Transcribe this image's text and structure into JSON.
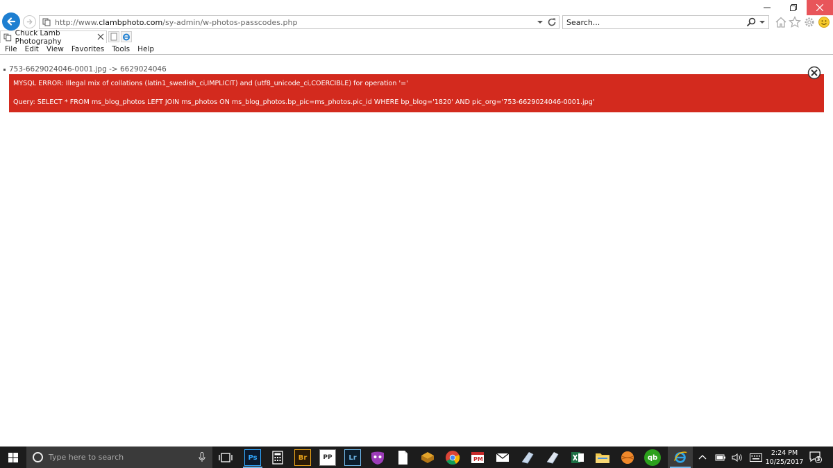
{
  "browser": {
    "url_prefix": "http://www.",
    "url_domain": "clambphoto.com",
    "url_path": "/sy-admin/w-photos-passcodes.php",
    "search_placeholder": "Search...",
    "tab_title": "Chuck Lamb Photography"
  },
  "menu": [
    "File",
    "Edit",
    "View",
    "Favorites",
    "Tools",
    "Help"
  ],
  "page": {
    "file_line": "753-6629024046-0001.jpg -> 6629024046",
    "error_line": "MYSQL ERROR: Illegal mix of collations (latin1_swedish_ci,IMPLICIT) and (utf8_unicode_ci,COERCIBLE) for operation '='",
    "query_line": "Query: SELECT * FROM ms_blog_photos LEFT JOIN ms_photos ON ms_blog_photos.bp_pic=ms_photos.pic_id WHERE bp_blog='1820' AND pic_org='753-6629024046-0001.jpg'"
  },
  "taskbar": {
    "search_placeholder": "Type here to search",
    "time": "2:24 PM",
    "date": "10/25/2017",
    "notification_count": "3",
    "apps": [
      {
        "label": "Ps"
      },
      {
        "label": "Br"
      },
      {
        "label": "PP"
      },
      {
        "label": "Lr"
      },
      {
        "label": "qb"
      }
    ]
  },
  "colors": {
    "error_bg": "#d32a1e",
    "accent": "#1e7fd1",
    "taskbar": "#1c1c1c"
  }
}
